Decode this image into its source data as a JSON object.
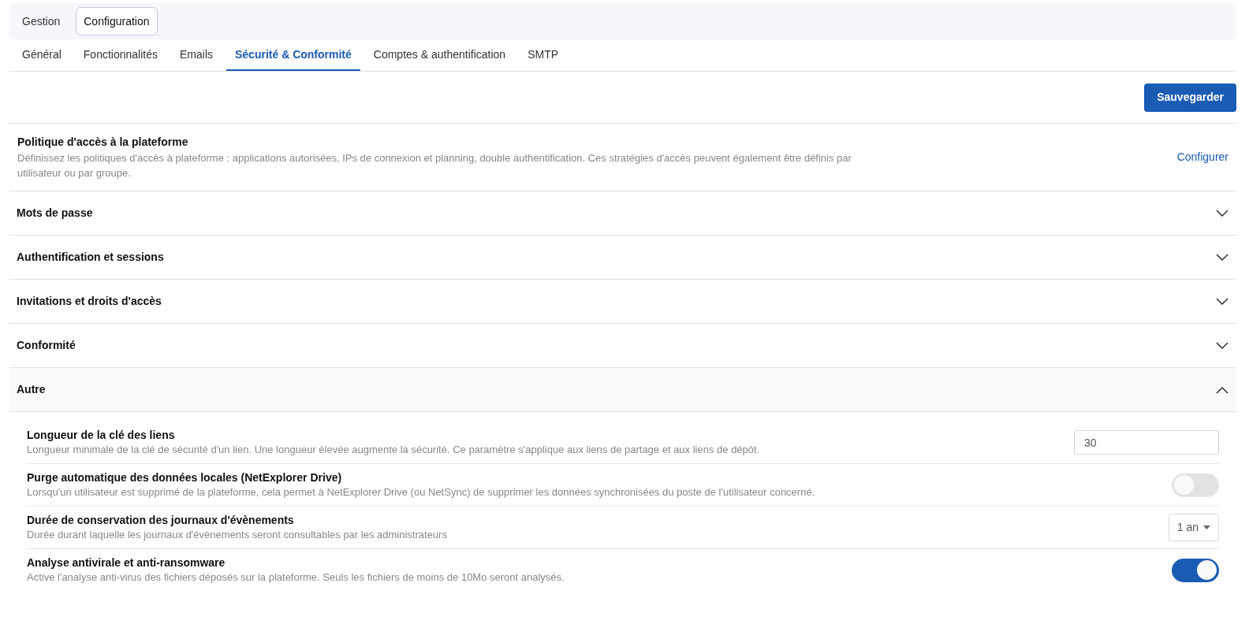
{
  "top_tabs": [
    {
      "label": "Gestion",
      "selected": false
    },
    {
      "label": "Configuration",
      "selected": true
    }
  ],
  "sub_tabs": [
    {
      "label": "Général",
      "selected": false
    },
    {
      "label": "Fonctionnalités",
      "selected": false
    },
    {
      "label": "Emails",
      "selected": false
    },
    {
      "label": "Sécurité & Conformité",
      "selected": true
    },
    {
      "label": "Comptes & authentification",
      "selected": false
    },
    {
      "label": "SMTP",
      "selected": false
    }
  ],
  "save_button": "Sauvegarder",
  "policy": {
    "title": "Politique d'accès à la plateforme",
    "description": "Définissez les politiques d'accès à plateforme : applications autorisées, IPs de connexion et planning, double authentification. Ces stratégies d'accès peuvent également être définis par utilisateur ou par groupe.",
    "link": "Configurer"
  },
  "sections": [
    {
      "title": "Mots de passe",
      "expanded": false
    },
    {
      "title": "Authentification et sessions",
      "expanded": false
    },
    {
      "title": "Invitations et droits d'accès",
      "expanded": false
    },
    {
      "title": "Conformité",
      "expanded": false
    },
    {
      "title": "Autre",
      "expanded": true,
      "settings": [
        {
          "kind": "input",
          "title": "Longueur de la clé des liens",
          "description": "Longueur minimale de la clé de sécurité d'un lien. Une longueur élevée augmente la sécurité. Ce paramètre s'applique aux liens de partage et aux liens de dépôt.",
          "value": "30"
        },
        {
          "kind": "toggle",
          "title": "Purge automatique des données locales (NetExplorer Drive)",
          "description": "Lorsqu'un utilisateur est supprimé de la plateforme, cela permet à NetExplorer Drive (ou NetSync) de supprimer les données synchronisées du poste de l'utilisateur concerné.",
          "on": false
        },
        {
          "kind": "select",
          "title": "Durée de conservation des journaux d'évènements",
          "description": "Durée durant laquelle les journaux d'évènements seront consultables par les administrateurs",
          "value": "1 an"
        },
        {
          "kind": "toggle",
          "title": "Analyse antivirale et anti-ransomware",
          "description": "Active l'analyse anti-virus des fichiers déposés sur la plateforme. Seuls les fichiers de moins de 10Mo seront analysés.",
          "on": true
        }
      ]
    }
  ]
}
